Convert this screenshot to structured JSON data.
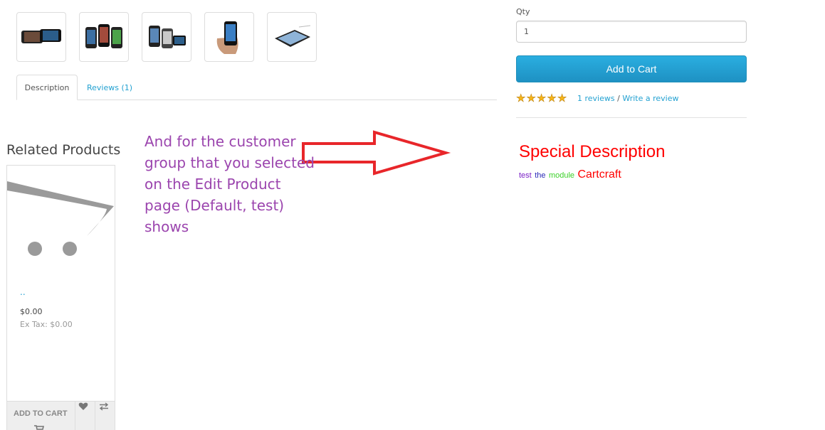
{
  "thumbnails": [
    {
      "icon": "iphone-landscape-image"
    },
    {
      "icon": "iphone-group-image"
    },
    {
      "icon": "iphone-apps-image"
    },
    {
      "icon": "iphone-hand-image"
    },
    {
      "icon": "iphone-side-image"
    }
  ],
  "tabs": {
    "description": "Description",
    "reviews": "Reviews (1)"
  },
  "purchase": {
    "qty_label": "Qty",
    "qty_value": "1",
    "add_to_cart": "Add to Cart",
    "rating": 5,
    "reviews_link": "1 reviews",
    "separator": " / ",
    "write_review": "Write a review"
  },
  "annotation": {
    "lines": [
      "And for the customer",
      "group that you selected",
      "on the Edit Product",
      "page (Default, test)",
      "shows"
    ],
    "color": "#9b45ae"
  },
  "special": {
    "title": "Special Description",
    "word1": "test",
    "word2": "the",
    "word3": "module",
    "word4": "Cartcraft",
    "color": "#ff0000"
  },
  "related": {
    "heading": "Related Products",
    "product": {
      "name": "..",
      "price": "$0.00",
      "ex_tax": "Ex Tax: $0.00",
      "add_to_cart": "ADD TO CART",
      "wishlist_icon": "heart-icon",
      "compare_icon": "compare-arrows-icon"
    }
  },
  "colors": {
    "accent": "#23a1d1",
    "button": "#2aaee0",
    "star": "#f7b519",
    "arrow": "#e8262a"
  }
}
